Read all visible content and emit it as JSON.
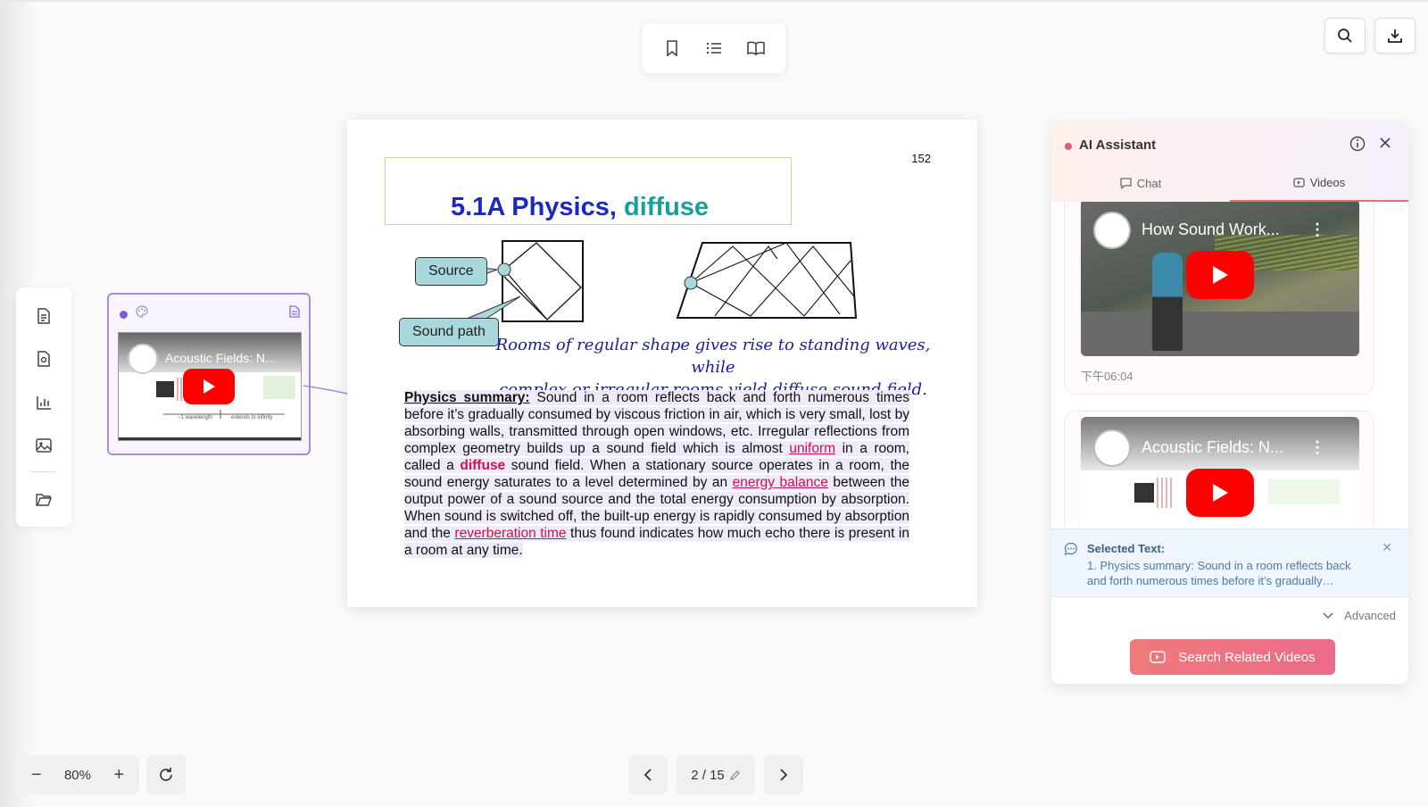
{
  "toolbar": {
    "bookmark_icon": "bookmark-icon",
    "list_icon": "list-icon",
    "book_icon": "book-open-icon"
  },
  "topright": {
    "search_icon": "search-icon",
    "download_icon": "download-icon"
  },
  "sidebar": {
    "items": [
      "document-icon",
      "document-search-icon",
      "bar-chart-icon",
      "image-icon",
      "folder-open-icon"
    ]
  },
  "floating_card": {
    "video_title": "Acoustic Fields: N...",
    "label_left": "~1 wavelength",
    "label_right": "extends to infinity"
  },
  "document": {
    "page_number": "152",
    "title_main": "5.1A Physics,",
    "title_accent": "diffuse",
    "callout_source": "Source",
    "callout_soundpath": "Sound path",
    "caption_line1": "Rooms of regular shape gives rise to standing waves, while",
    "caption_line2": "complex or irregular rooms yield diffuse sound field.",
    "summary": {
      "heading": "Physics summary:",
      "p1": " Sound in a room reflects back and forth numerous times before it’s gradually consumed by viscous friction in air, which is very small, lost by absorbing walls, transmitted through open windows, etc. Irregular reflections from complex geometry builds up a sound field which is almost ",
      "term_uniform": "uniform",
      "p2": " in a room, called a ",
      "term_diffuse": "diffuse",
      "p3": " sound field. When a stationary source operates in a room, the sound energy saturates to a level determined by an ",
      "term_energy": "energy balance",
      "p4": " between the output power of a sound source and the total energy consumption by absorption. When sound is switched off, the built-up energy is rapidly consumed by absorption and the ",
      "term_reverb": "reverberation time",
      "p5": " thus found indicates how much echo there is present in a room at any time."
    }
  },
  "assistant": {
    "title": "AI Assistant",
    "tab_chat": "Chat",
    "tab_videos": "Videos",
    "videos": [
      {
        "title": "How Sound Work...",
        "time": "下午06:04"
      },
      {
        "title": "Acoustic Fields: N..."
      }
    ],
    "selected_title": "Selected Text:",
    "selected_text": "1. Physics summary: Sound in a room reflects back and forth numerous times before it’s gradually…",
    "advanced": "Advanced",
    "search_button": "Search Related Videos",
    "accent": "#e86a78"
  },
  "zoom": {
    "level": "80%",
    "minus": "−",
    "plus": "+"
  },
  "pager": {
    "current": "2 / 15"
  }
}
